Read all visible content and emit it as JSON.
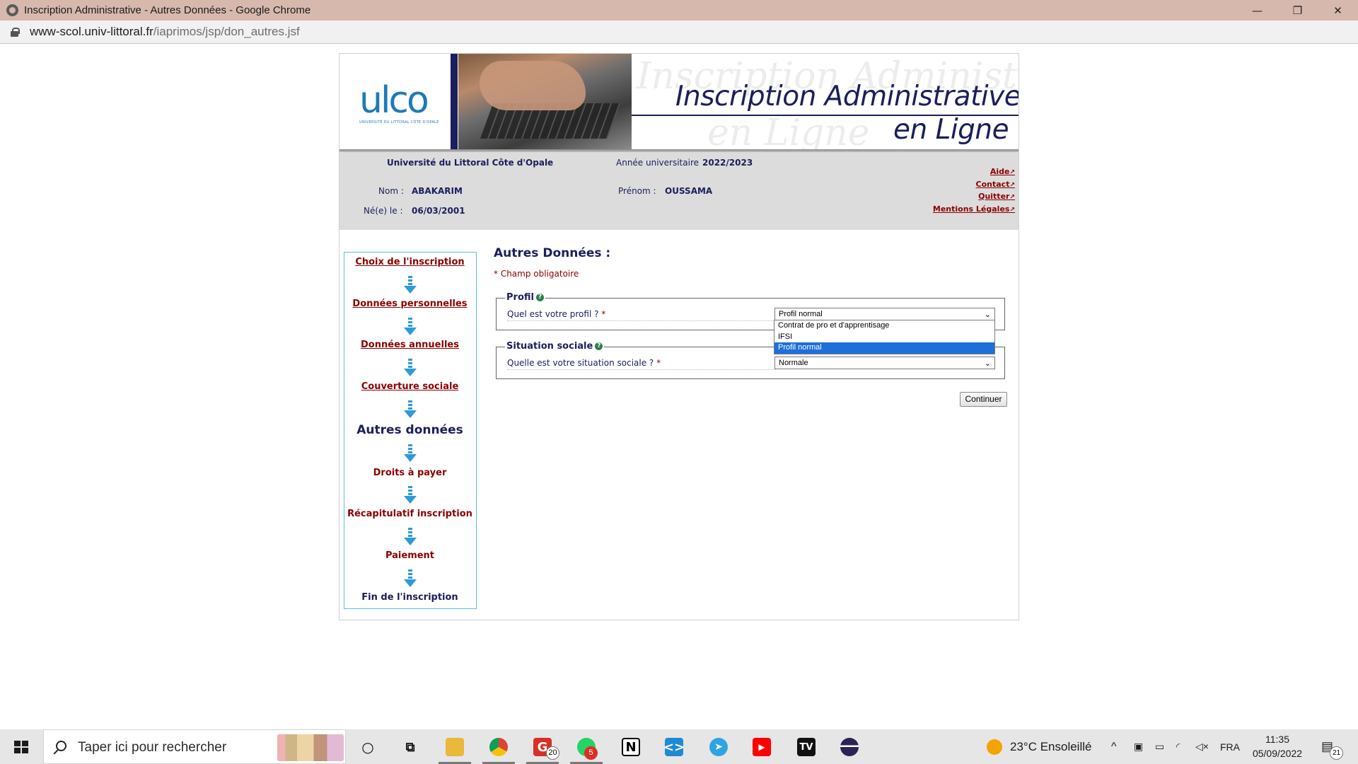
{
  "window": {
    "title": "Inscription Administrative - Autres Données - Google Chrome",
    "url_host": "www-scol.univ-littoral.fr",
    "url_path": "/iaprimos/jsp/don_autres.jsf",
    "minimize_glyph": "—",
    "restore_glyph": "❐",
    "close_glyph": "✕"
  },
  "banner": {
    "logo_text": "ulco",
    "logo_sub": "UNIVERSITÉ DU LITTORAL CÔTE D'OPALE",
    "title_line1": "Inscription Administrative",
    "title_line2": "en Ligne"
  },
  "info": {
    "university": "Université du Littoral Côte d'Opale",
    "year_label": "Année universitaire",
    "year_value": "2022/2023",
    "nom_label": "Nom :",
    "nom_value": "ABAKARIM",
    "prenom_label": "Prénom :",
    "prenom_value": "OUSSAMA",
    "born_label": "Né(e) le :",
    "born_value": "06/03/2001",
    "links": {
      "aide": "Aide",
      "contact": "Contact",
      "quitter": "Quitter",
      "mentions": "Mentions Légales"
    }
  },
  "steps": [
    {
      "label": "Choix de l'inscription",
      "state": "done"
    },
    {
      "label": "Données personnelles",
      "state": "done"
    },
    {
      "label": "Données annuelles",
      "state": "done"
    },
    {
      "label": "Couverture sociale",
      "state": "done"
    },
    {
      "label": "Autres données",
      "state": "current"
    },
    {
      "label": "Droits à payer",
      "state": "todo"
    },
    {
      "label": "Récapitulatif inscription",
      "state": "todo"
    },
    {
      "label": "Paiement",
      "state": "todo"
    },
    {
      "label": "Fin de l'inscription",
      "state": "last"
    }
  ],
  "main": {
    "title": "Autres Données :",
    "required_note": "* Champ obligatoire",
    "profil": {
      "legend": "Profil",
      "question": "Quel est votre profil ?",
      "star": "*",
      "selected": "Profil normal",
      "options": [
        "Contrat de pro et d'apprentisage",
        "IFSI",
        "Profil normal"
      ]
    },
    "situation": {
      "legend": "Situation sociale",
      "question": "Quelle est votre situation sociale ?",
      "star": "*",
      "selected": "Normale"
    },
    "continue_label": "Continuer",
    "help_glyph": "?"
  },
  "taskbar": {
    "search_placeholder": "Taper ici pour rechercher",
    "gmail_badge": "20",
    "whatsapp_badge": "5",
    "weather": "23°C  Ensoleillé",
    "language": "FRA",
    "time": "11:35",
    "date": "05/09/2022",
    "notif_count": "21"
  },
  "colors": {
    "navy": "#1a1f5c",
    "link_red": "#8b0000",
    "step_border": "#5bc0de",
    "arrow_blue": "#2e9bd6",
    "selection_blue": "#1e6fd9"
  }
}
